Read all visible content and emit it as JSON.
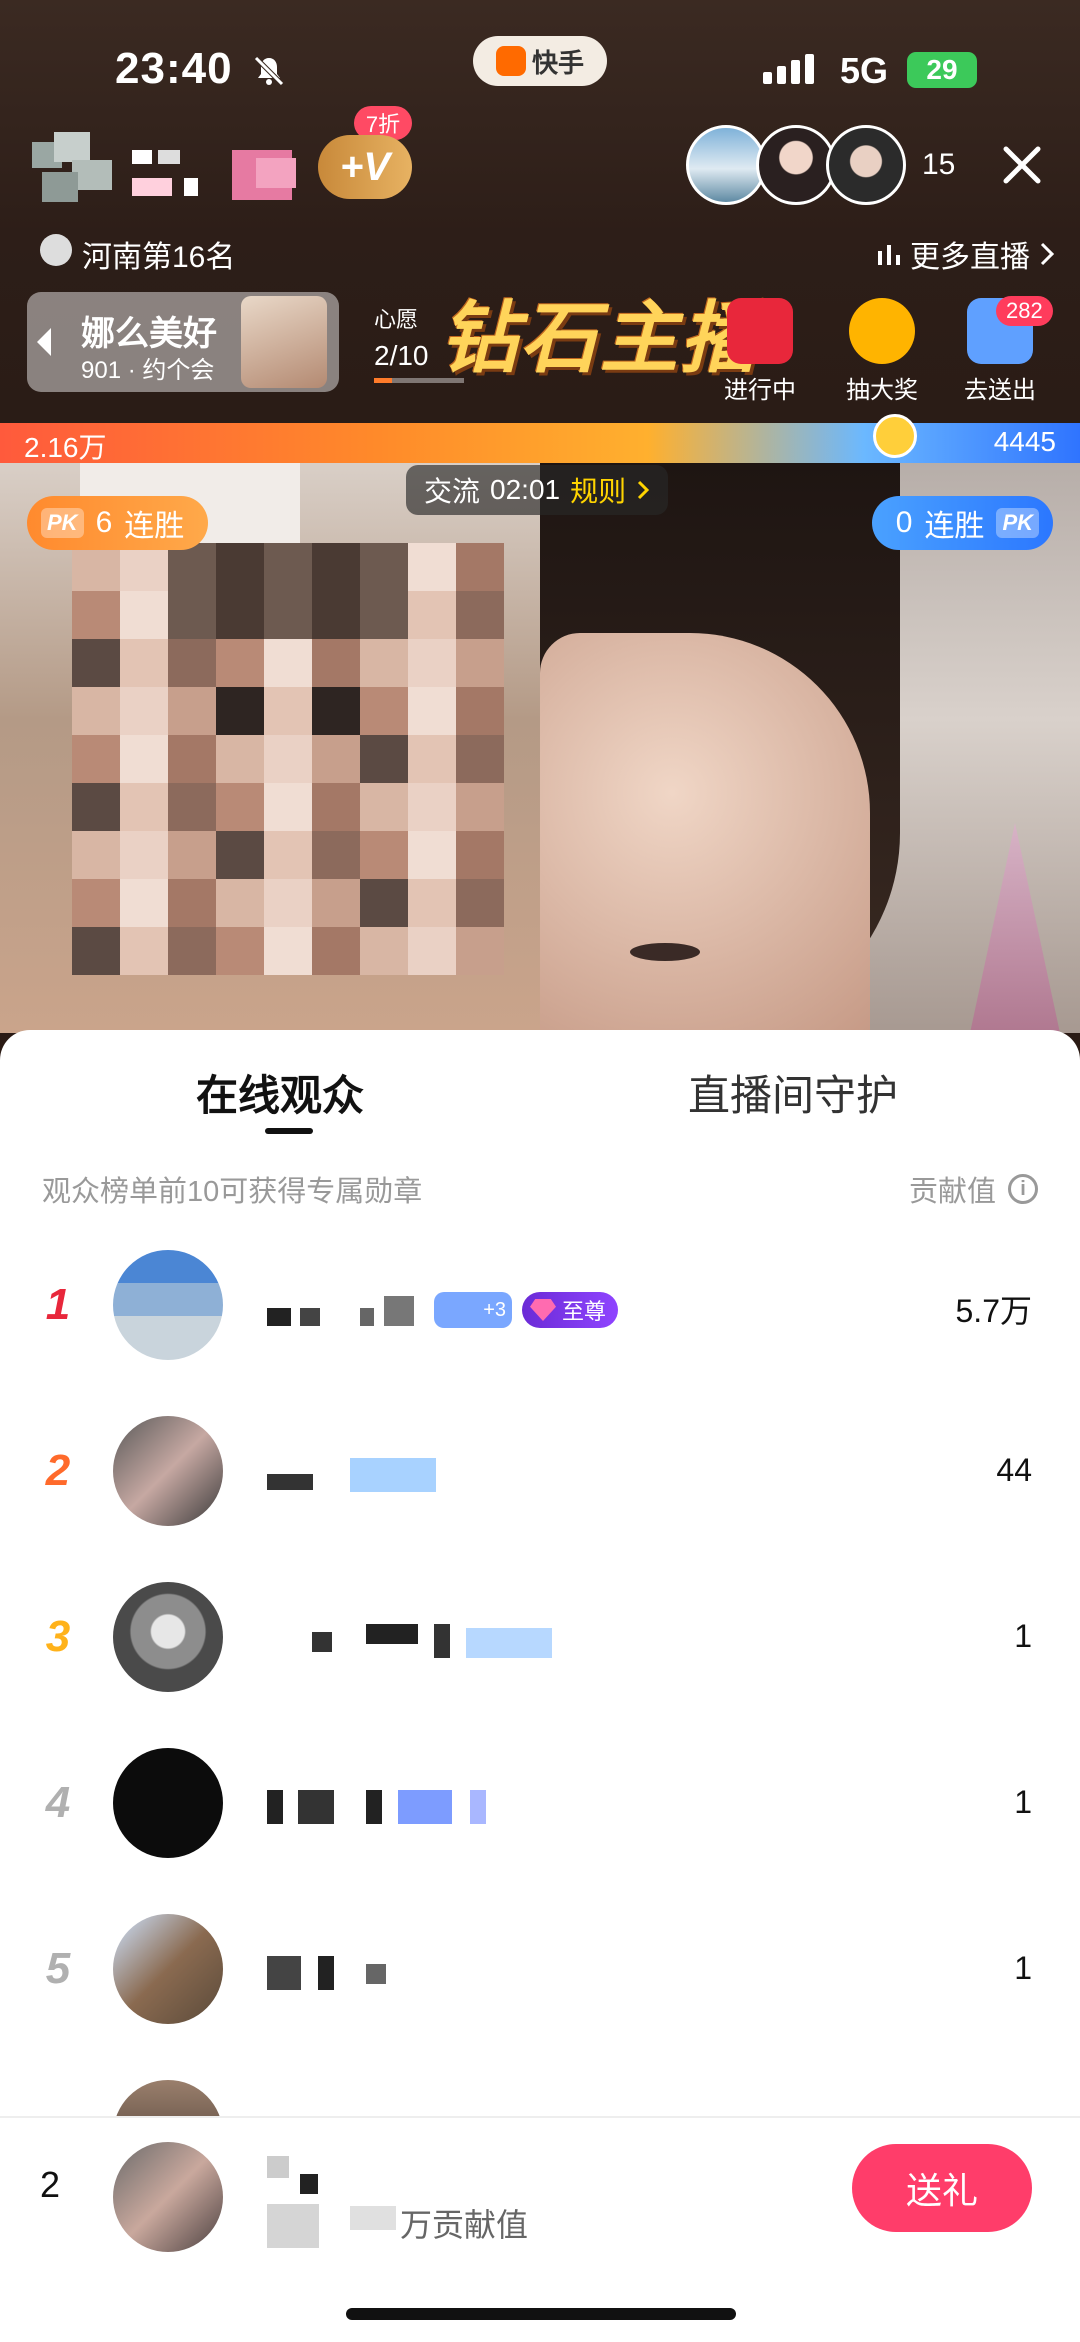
{
  "status_bar": {
    "time": "23:40",
    "app_name": "快手",
    "network": "5G",
    "battery": "29"
  },
  "header": {
    "discount_badge": "7折",
    "vip_mark": "+V",
    "viewer_count": "15",
    "rank_text": "河南第16名",
    "more_live_label": "更多直播"
  },
  "promo": {
    "name": "娜么美好",
    "sub": "901 · 约个会"
  },
  "wish": {
    "label": "心愿",
    "progress": "2/10",
    "ratio": 0.2
  },
  "event_title": "钻石主播",
  "entries": [
    {
      "label": "进行中",
      "color": "#e8273b"
    },
    {
      "label": "抽大奖",
      "color": "#ffb400"
    },
    {
      "label": "去送出",
      "color": "#5fa0ff"
    }
  ],
  "entry_badge": "282",
  "pk_bar": {
    "left_score": "2.16万",
    "right_score": "4445"
  },
  "exchange": {
    "label": "交流",
    "timer": "02:01",
    "rule": "规则"
  },
  "streak_left": {
    "pk": "PK",
    "count": "6",
    "label": "连胜"
  },
  "streak_right": {
    "pk": "PK",
    "count": "0",
    "label": "连胜"
  },
  "panel": {
    "tabs": [
      "在线观众",
      "直播间守护"
    ],
    "hint": "观众榜单前10可获得专属勋章",
    "contribution_header": "贡献值",
    "info_icon": "info-icon",
    "supreme_badge": "至尊",
    "level_badge": "+3",
    "rows": [
      {
        "rank": "1",
        "score": "5.7万"
      },
      {
        "rank": "2",
        "score": "44"
      },
      {
        "rank": "3",
        "score": "1"
      },
      {
        "rank": "4",
        "score": "1"
      },
      {
        "rank": "5",
        "score": "1"
      }
    ]
  },
  "my_status": {
    "rank": "2",
    "label": "万贡献值"
  },
  "gift_button": "送礼",
  "colors": {
    "rank1": "#e8273b",
    "rank2": "#ff6a2b",
    "rank3": "#ffb21a",
    "rank_other": "#b0b0b0",
    "gift": "#ff3d6a"
  }
}
